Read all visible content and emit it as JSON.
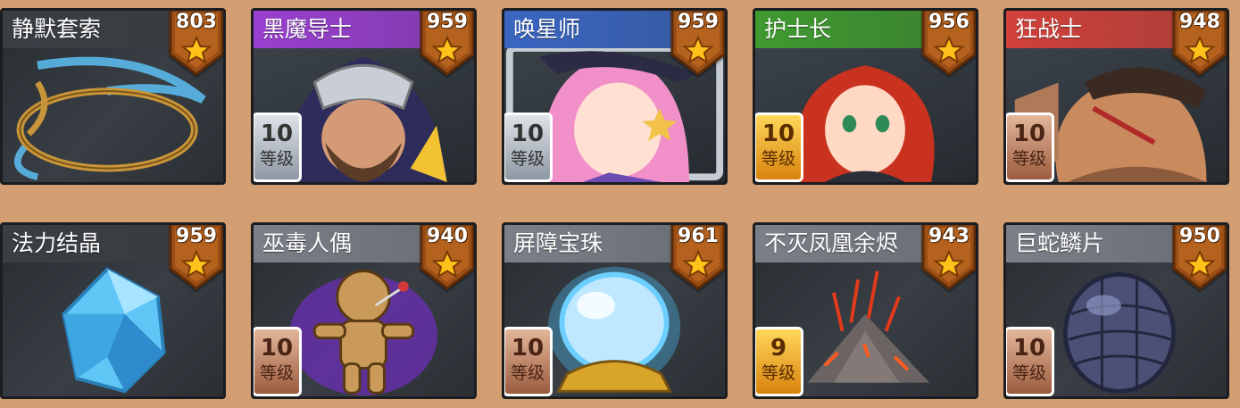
{
  "colors": {
    "background": "#d39f72",
    "card": "#2f3438",
    "title_dark": "#3b3f44",
    "title_purple": "#9a3fd0",
    "title_blue": "#3a66c2",
    "title_green": "#3f9a2f",
    "title_red": "#d2413a",
    "title_gray": "#7b8088",
    "badge": "#9a4e15",
    "star": "#ffc21a"
  },
  "cards": [
    {
      "name": "静默套索",
      "score": "803",
      "level": null,
      "title_color": "#3b3f44",
      "art_icon": "lasso-icon"
    },
    {
      "name": "黑魔导士",
      "score": "959",
      "level": "10",
      "level_label": "等级",
      "level_style": "gray",
      "title_color": "#9a3fd0",
      "art_icon": "dark-mage-portrait"
    },
    {
      "name": "唤星师",
      "score": "959",
      "level": "10",
      "level_label": "等级",
      "level_style": "gray",
      "title_color": "#3a66c2",
      "art_icon": "star-caller-portrait"
    },
    {
      "name": "护士长",
      "score": "956",
      "level": "10",
      "level_label": "等级",
      "level_style": "gold",
      "title_color": "#3f9a2f",
      "art_icon": "head-nurse-portrait"
    },
    {
      "name": "狂战士",
      "score": "948",
      "level": "10",
      "level_label": "等级",
      "level_style": "brown",
      "title_color": "#d2413a",
      "art_icon": "berserker-portrait"
    },
    {
      "name": "法力结晶",
      "score": "959",
      "level": null,
      "title_color": "#3b3f44",
      "art_icon": "mana-crystal-icon"
    },
    {
      "name": "巫毒人偶",
      "score": "940",
      "level": "10",
      "level_label": "等级",
      "level_style": "brown",
      "title_color": "#7b8088",
      "art_icon": "voodoo-doll-icon"
    },
    {
      "name": "屏障宝珠",
      "score": "961",
      "level": "10",
      "level_label": "等级",
      "level_style": "brown",
      "title_color": "#7b8088",
      "art_icon": "barrier-orb-icon"
    },
    {
      "name": "不灭凤凰余烬",
      "score": "943",
      "level": "9",
      "level_label": "等级",
      "level_style": "gold",
      "title_color": "#7b8088",
      "art_icon": "phoenix-ember-icon"
    },
    {
      "name": "巨蛇鳞片",
      "score": "950",
      "level": "10",
      "level_label": "等级",
      "level_style": "brown",
      "title_color": "#7b8088",
      "art_icon": "serpent-scale-icon"
    }
  ]
}
